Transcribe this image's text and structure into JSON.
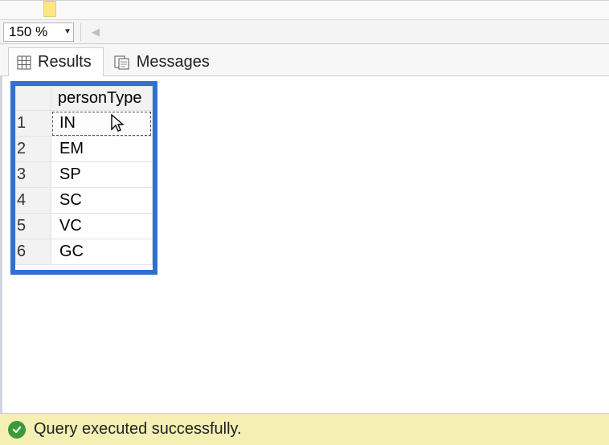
{
  "toolbar": {
    "zoom_value": "150 %"
  },
  "tabs": {
    "results_label": "Results",
    "messages_label": "Messages"
  },
  "grid": {
    "column_header": "personType",
    "rows": [
      {
        "n": "1",
        "v": "IN"
      },
      {
        "n": "2",
        "v": "EM"
      },
      {
        "n": "3",
        "v": "SP"
      },
      {
        "n": "4",
        "v": "SC"
      },
      {
        "n": "5",
        "v": "VC"
      },
      {
        "n": "6",
        "v": "GC"
      }
    ]
  },
  "status": {
    "message": "Query executed successfully."
  }
}
